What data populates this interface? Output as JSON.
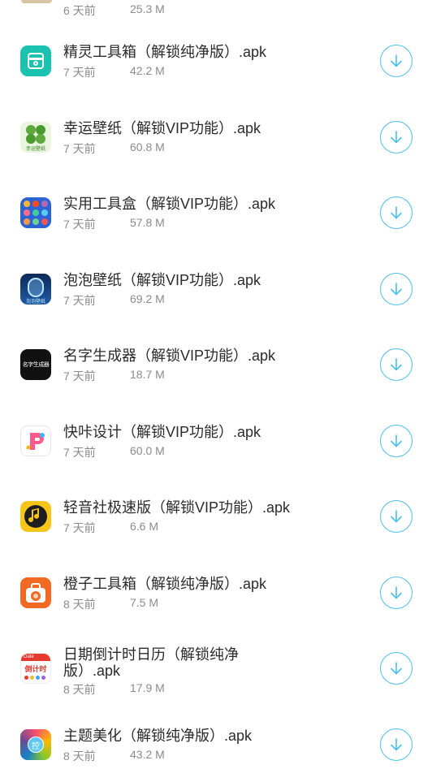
{
  "top_item": {
    "age": "6 天前",
    "size": "25.3 M"
  },
  "items": [
    {
      "title": "精灵工具箱（解锁纯净版）.apk",
      "age": "7 天前",
      "size": "42.2 M",
      "icon": "toolbox-icon",
      "color": "#1bc2b0"
    },
    {
      "title": "幸运壁纸（解锁VIP功能）.apk",
      "age": "7 天前",
      "size": "60.8 M",
      "icon": "clover-wallpaper-icon",
      "color": "#5fa83c"
    },
    {
      "title": "实用工具盒（解锁VIP功能）.apk",
      "age": "7 天前",
      "size": "57.8 M",
      "icon": "tool-grid-icon",
      "color": "#2e63d6"
    },
    {
      "title": "泡泡壁纸（解锁VIP功能）.apk",
      "age": "7 天前",
      "size": "69.2 M",
      "icon": "bubble-wallpaper-icon",
      "color": "#1b3f7a"
    },
    {
      "title": "名字生成器（解锁VIP功能）.apk",
      "age": "7 天前",
      "size": "18.7 M",
      "icon": "name-generator-icon",
      "color": "#111111"
    },
    {
      "title": "快咔设计（解锁VIP功能）.apk",
      "age": "7 天前",
      "size": "60.0 M",
      "icon": "kuaika-design-icon",
      "color": "#ffffff"
    },
    {
      "title": "轻音社极速版（解锁VIP功能）.apk",
      "age": "7 天前",
      "size": "6.6 M",
      "icon": "music-note-icon",
      "color": "#f7c51a"
    },
    {
      "title": "橙子工具箱（解锁纯净版）.apk",
      "age": "8 天前",
      "size": "7.5 M",
      "icon": "orange-toolbox-icon",
      "color": "#f26a21"
    },
    {
      "title": "日期倒计时日历（解锁纯净版）.apk",
      "age": "8 天前",
      "size": "17.9 M",
      "icon": "countdown-calendar-icon",
      "color": "#e43a2f"
    },
    {
      "title": "主题美化（解锁纯净版）.apk",
      "age": "8 天前",
      "size": "43.2 M",
      "icon": "theme-palette-icon",
      "color": "#9b5de5"
    }
  ],
  "icon_texts": {
    "clover": "幸运壁纸",
    "bubble": "泡泡壁纸",
    "name_gen": "名字生成器",
    "cal_badge": "Date",
    "cal_main": "倒计时",
    "theme": "控"
  },
  "accent_color": "#4cc0ea"
}
